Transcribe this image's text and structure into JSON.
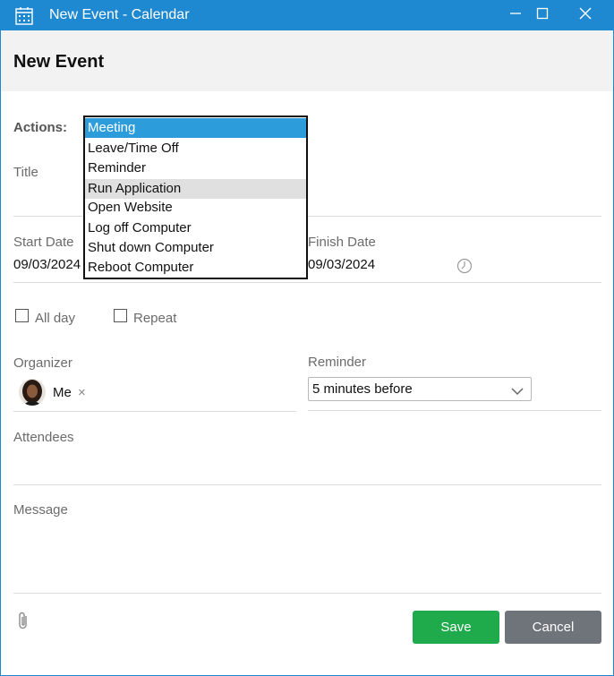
{
  "window": {
    "title": "New Event - Calendar"
  },
  "header": {
    "title": "New Event"
  },
  "form": {
    "actions_label": "Actions:",
    "actions_options": [
      "Meeting",
      "Leave/Time Off",
      "Reminder",
      "Run Application",
      "Open Website",
      "Log off Computer",
      "Shut down Computer",
      "Reboot Computer"
    ],
    "actions_selected": "Meeting",
    "actions_hovered": "Run Application",
    "title_label": "Title",
    "start_date_label": "Start Date",
    "start_date_value": "09/03/2024",
    "finish_date_label": "Finish Date",
    "finish_date_value": "09/03/2024",
    "all_day_label": "All day",
    "repeat_label": "Repeat",
    "organizer_label": "Organizer",
    "organizer_name": "Me",
    "organizer_remove": "×",
    "reminder_label": "Reminder",
    "reminder_value": "5 minutes before",
    "attendees_label": "Attendees",
    "message_label": "Message"
  },
  "footer": {
    "save_label": "Save",
    "cancel_label": "Cancel"
  },
  "colors": {
    "titlebar": "#1e88d0",
    "selected_option": "#2d9cdb",
    "save_button": "#1faa4b",
    "cancel_button": "#6f747a"
  },
  "icons": {
    "app": "calendar-icon",
    "clock": "clock-icon",
    "attachment": "paperclip-icon",
    "dropdown": "chevron-down-icon"
  }
}
